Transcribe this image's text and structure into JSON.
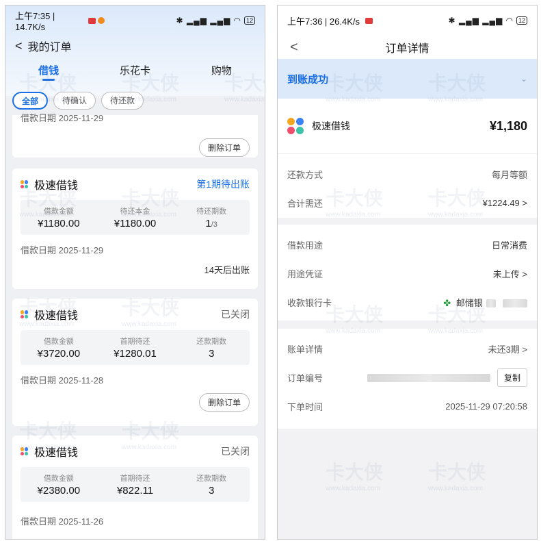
{
  "left": {
    "status": {
      "time": "上午7:35 | 14.7K/s",
      "battery": "12"
    },
    "nav": {
      "back": "<",
      "title": "我的订单"
    },
    "tabs": [
      "借钱",
      "乐花卡",
      "购物"
    ],
    "filters": [
      "全部",
      "待确认",
      "待还款"
    ],
    "top_partial": {
      "date_cut": "借款日期 2025-11-29",
      "delete_label": "删除订单"
    },
    "cards": [
      {
        "title": "极速借钱",
        "status": "第1期待出账",
        "stats": [
          {
            "label": "借款金额",
            "value": "¥1180.00"
          },
          {
            "label": "待还本金",
            "value": "¥1180.00"
          },
          {
            "label": "待还期数",
            "value": "1",
            "suffix": "/3"
          }
        ],
        "date": "借款日期 2025-11-29",
        "foot": "14天后出账"
      },
      {
        "title": "极速借钱",
        "status": "已关闭",
        "stats": [
          {
            "label": "借款金额",
            "value": "¥3720.00"
          },
          {
            "label": "首期待还",
            "value": "¥1280.01"
          },
          {
            "label": "还款期数",
            "value": "3"
          }
        ],
        "date": "借款日期 2025-11-28",
        "foot": "删除订单"
      },
      {
        "title": "极速借钱",
        "status": "已关闭",
        "stats": [
          {
            "label": "借款金额",
            "value": "¥2380.00"
          },
          {
            "label": "首期待还",
            "value": "¥822.11"
          },
          {
            "label": "还款期数",
            "value": "3"
          }
        ],
        "date": "借款日期 2025-11-26"
      }
    ]
  },
  "right": {
    "status": {
      "time": "上午7:36 | 26.4K/s",
      "battery": "12"
    },
    "nav": {
      "back": "<",
      "title": "订单详情"
    },
    "banner": {
      "text": "到账成功",
      "chevron": "⌄"
    },
    "product": {
      "name": "极速借钱",
      "amount": "¥1,180"
    },
    "repay": [
      {
        "key": "还款方式",
        "value": "每月等额"
      },
      {
        "key": "合计需还",
        "value": "¥1224.49 >"
      }
    ],
    "usage": [
      {
        "key": "借款用途",
        "value": "日常消费"
      },
      {
        "key": "用途凭证",
        "value": "未上传 >"
      },
      {
        "key": "收款银行卡",
        "value": "邮储银"
      }
    ],
    "order": [
      {
        "key": "账单详情",
        "value": "未还3期 >"
      },
      {
        "key": "订单编号",
        "copy": "复制"
      },
      {
        "key": "下单时间",
        "value": "2025-11-29 07:20:58"
      }
    ]
  },
  "watermark": {
    "brand": "卡大侠",
    "url": "www.kadaxia.com"
  },
  "colors": {
    "accent": "#1a6fe6",
    "banner": "#dbe9fb",
    "bank_green": "#1f9b3a"
  },
  "icons": {
    "status": [
      "bluetooth-icon",
      "signal-icon",
      "wifi-icon",
      "battery-icon"
    ],
    "product_logo": "four-dot-logo-icon",
    "bank": "postal-bank-icon"
  }
}
